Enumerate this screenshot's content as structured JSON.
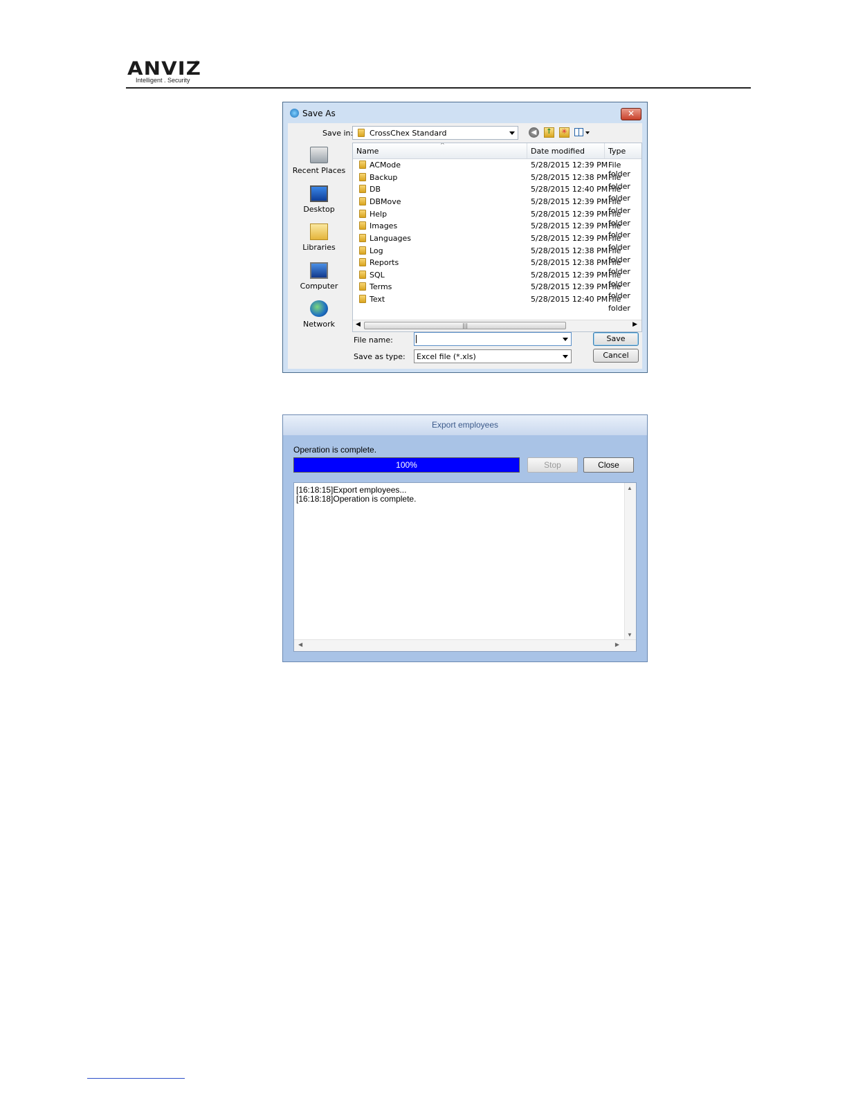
{
  "header": {
    "logo_text": "ANVIZ",
    "logo_registered": "®",
    "tagline": "Intelligent . Security"
  },
  "save_dialog": {
    "title": "Save As",
    "close_glyph": "✕",
    "save_in_label": "Save in:",
    "save_in_value": "CrossChex Standard",
    "places": [
      "Recent Places",
      "Desktop",
      "Libraries",
      "Computer",
      "Network"
    ],
    "columns": {
      "name": "Name",
      "date": "Date modified",
      "type": "Type"
    },
    "rows": [
      {
        "name": "ACMode",
        "date": "5/28/2015 12:39 PM",
        "type": "File folder"
      },
      {
        "name": "Backup",
        "date": "5/28/2015 12:38 PM",
        "type": "File folder"
      },
      {
        "name": "DB",
        "date": "5/28/2015 12:40 PM",
        "type": "File folder"
      },
      {
        "name": "DBMove",
        "date": "5/28/2015 12:39 PM",
        "type": "File folder"
      },
      {
        "name": "Help",
        "date": "5/28/2015 12:39 PM",
        "type": "File folder"
      },
      {
        "name": "Images",
        "date": "5/28/2015 12:39 PM",
        "type": "File folder"
      },
      {
        "name": "Languages",
        "date": "5/28/2015 12:39 PM",
        "type": "File folder"
      },
      {
        "name": "Log",
        "date": "5/28/2015 12:38 PM",
        "type": "File folder"
      },
      {
        "name": "Reports",
        "date": "5/28/2015 12:38 PM",
        "type": "File folder"
      },
      {
        "name": "SQL",
        "date": "5/28/2015 12:39 PM",
        "type": "File folder"
      },
      {
        "name": "Terms",
        "date": "5/28/2015 12:39 PM",
        "type": "File folder"
      },
      {
        "name": "Text",
        "date": "5/28/2015 12:40 PM",
        "type": "File folder"
      }
    ],
    "file_name_label": "File name:",
    "file_name_value": "",
    "save_type_label": "Save as type:",
    "save_type_value": "Excel file (*.xls)",
    "save_button": "Save",
    "cancel_button": "Cancel"
  },
  "export_dialog": {
    "title": "Export employees",
    "status": "Operation is complete.",
    "progress_text": "100%",
    "progress_fraction": 1.0,
    "stop_button": "Stop",
    "close_button": "Close",
    "log": [
      "[16:18:15]Export employees...",
      "[16:18:18]Operation is complete."
    ]
  },
  "colors": {
    "progress_fill": "#0000ff",
    "export_background": "#a9c3e6",
    "save_dialog_frame": "#cfe0f3"
  }
}
